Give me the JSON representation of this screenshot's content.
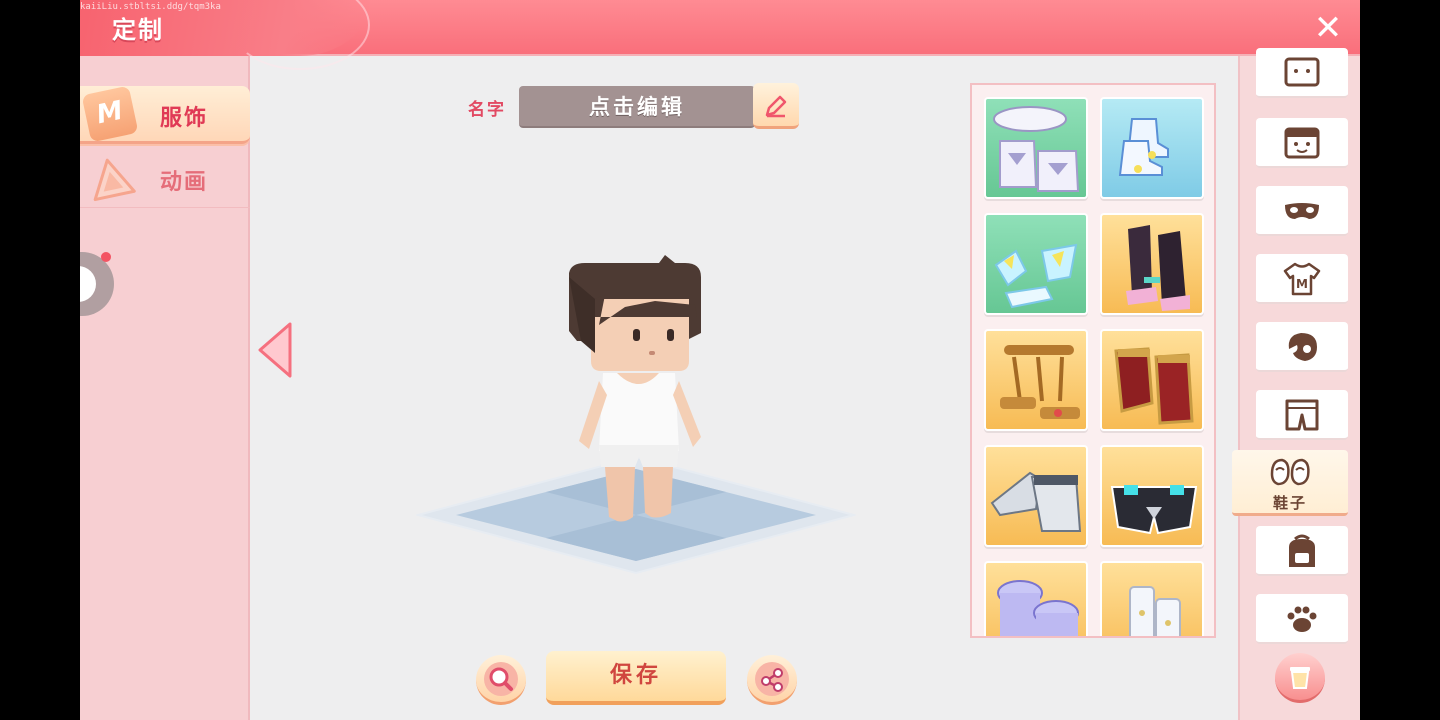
{
  "header": {
    "title": "定制",
    "close_label": "✕",
    "watermark": "kaiiLiu.stbltsi.ddg/tqm3ka"
  },
  "left_tabs": [
    {
      "label": "服饰",
      "icon": "shirt-m-icon",
      "active": true
    },
    {
      "label": "动画",
      "icon": "triangle-icon",
      "active": false
    }
  ],
  "name_editor": {
    "label": "名字",
    "value": "点击编辑"
  },
  "save_button": {
    "label": "保存"
  },
  "items": [
    {
      "icon": "collar-boots-icon",
      "bg": "green"
    },
    {
      "icon": "blue-sneakers-icon",
      "bg": "blue"
    },
    {
      "icon": "butterfly-shoes-icon",
      "bg": "green"
    },
    {
      "icon": "dark-boots-icon",
      "bg": "gold"
    },
    {
      "icon": "gold-sandals-icon",
      "bg": "gold"
    },
    {
      "icon": "red-boots-icon",
      "bg": "gold"
    },
    {
      "icon": "silver-boots-icon",
      "bg": "gold"
    },
    {
      "icon": "cyber-shoes-icon",
      "bg": "gold"
    },
    {
      "icon": "purple-boots-icon",
      "bg": "gold"
    },
    {
      "icon": "white-boots-icon",
      "bg": "gold"
    }
  ],
  "categories": [
    {
      "icon": "face-top-icon"
    },
    {
      "icon": "face-icon"
    },
    {
      "icon": "mask-icon"
    },
    {
      "icon": "shirt-icon"
    },
    {
      "icon": "hair-icon"
    },
    {
      "icon": "pants-icon"
    },
    {
      "icon": "shoes-icon",
      "label": "鞋子",
      "active": true
    },
    {
      "icon": "backpack-icon"
    },
    {
      "icon": "paw-icon"
    }
  ],
  "colors": {
    "header": "#f96f7b",
    "accent": "#e03a55",
    "panel": "#f7cfd2",
    "background": "#eeeeef"
  }
}
